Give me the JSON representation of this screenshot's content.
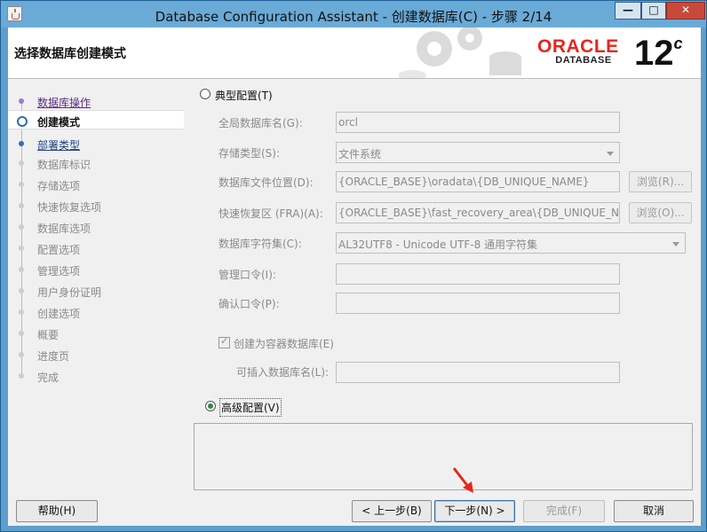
{
  "window": {
    "title": "Database Configuration Assistant - 创建数据库(C) - 步骤 2/14",
    "controls": {
      "minimize": "—",
      "maximize": "□",
      "close": "✕"
    }
  },
  "header": {
    "page_title": "选择数据库创建模式",
    "brand_word": "ORACLE",
    "brand_sub": "DATABASE",
    "version": "12",
    "version_suffix": "c"
  },
  "nav": {
    "items": [
      {
        "label": "数据库操作",
        "state": "link"
      },
      {
        "label": "创建模式",
        "state": "current"
      },
      {
        "label": "部署类型",
        "state": "next"
      },
      {
        "label": "数据库标识",
        "state": "disabled"
      },
      {
        "label": "存储选项",
        "state": "disabled"
      },
      {
        "label": "快速恢复选项",
        "state": "disabled"
      },
      {
        "label": "数据库选项",
        "state": "disabled"
      },
      {
        "label": "配置选项",
        "state": "disabled"
      },
      {
        "label": "管理选项",
        "state": "disabled"
      },
      {
        "label": "用户身份证明",
        "state": "disabled"
      },
      {
        "label": "创建选项",
        "state": "disabled"
      },
      {
        "label": "概要",
        "state": "disabled"
      },
      {
        "label": "进度页",
        "state": "disabled"
      },
      {
        "label": "完成",
        "state": "disabled"
      }
    ]
  },
  "form": {
    "typical": {
      "label": "典型配置(T)",
      "selected": false
    },
    "global_db_name": {
      "label": "全局数据库名(G):",
      "value": "orcl"
    },
    "storage_type": {
      "label": "存储类型(S):",
      "value": "文件系统"
    },
    "db_file_location": {
      "label": "数据库文件位置(D):",
      "value": "{ORACLE_BASE}\\oradata\\{DB_UNIQUE_NAME}",
      "browse": "浏览(R)..."
    },
    "fra": {
      "label": "快速恢复区 (FRA)(A):",
      "value": "{ORACLE_BASE}\\fast_recovery_area\\{DB_UNIQUE_NAME}",
      "browse": "浏览(O)..."
    },
    "charset": {
      "label": "数据库字符集(C):",
      "value": "AL32UTF8 - Unicode UTF-8 通用字符集"
    },
    "admin_password": {
      "label": "管理口令(I):",
      "value": ""
    },
    "confirm_password": {
      "label": "确认口令(P):",
      "value": ""
    },
    "container_db": {
      "label": "创建为容器数据库(E)",
      "checked": true
    },
    "pluggable_name": {
      "label": "可插入数据库名(L):",
      "value": ""
    },
    "advanced": {
      "label": "高级配置(V)",
      "selected": true
    }
  },
  "buttons": {
    "help": "帮助(H)",
    "back": "< 上一步(B)",
    "next": "下一步(N) >",
    "finish": "完成(F)",
    "cancel": "取消"
  },
  "colors": {
    "titlebar": "#6aaad6",
    "window_border": "#5f9ecb",
    "oracle_red": "#e8261c",
    "close_button": "#c7493a"
  }
}
